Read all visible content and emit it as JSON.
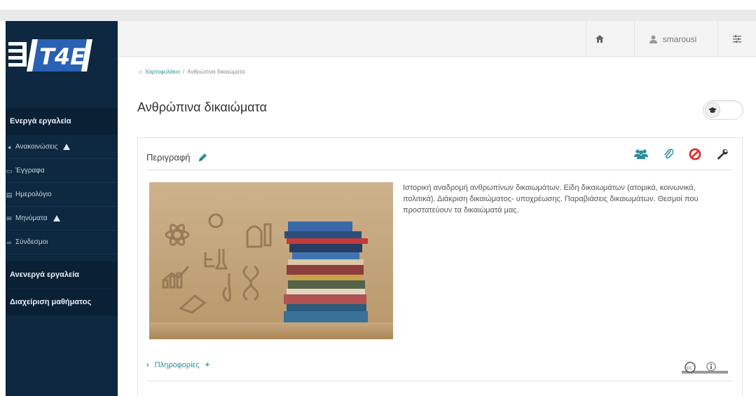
{
  "logo": {
    "text": "T4E"
  },
  "sidebar": {
    "active_tools_header": "Ενεργά εργαλεία",
    "items": [
      {
        "label": "Ανακοινώσεις",
        "icon": "announcement-icon",
        "warning": true
      },
      {
        "label": "Έγγραφα",
        "icon": "folder-icon",
        "warning": false
      },
      {
        "label": "Ημερολόγιο",
        "icon": "calendar-icon",
        "warning": false
      },
      {
        "label": "Μηνύματα",
        "icon": "envelope-icon",
        "warning": true
      },
      {
        "label": "Σύνδεσμοι",
        "icon": "link-icon",
        "warning": false
      }
    ],
    "inactive_tools_header": "Ανενεργά εργαλεία",
    "course_admin_header": "Διαχείριση μαθήματος"
  },
  "header": {
    "home_icon": "home-icon",
    "username": "smarousi",
    "user_icon": "user-icon",
    "settings_icon": "sliders-icon"
  },
  "breadcrumb": {
    "home": "Χαρτοφυλάκιο",
    "separator": "/",
    "current": "Ανθρώπινα δικαιώματα"
  },
  "page": {
    "title": "Ανθρώπινα δικαιώματα"
  },
  "panel": {
    "heading": "Περιγραφή",
    "description": "Ιστορική αναδρομή ανθρωπίνων δικαιωμάτων. Είδη δικαιωμάτων (ατομικά, κοινωνικά, πολιτικά). Διάκριση δικαιώματος- υποχρέωσης. Παραβιάσεις δικαιωμάτων. Θεσμοί που προστατεύουν τα δικαιώματά μας.",
    "info_label": "Πληροφορίες",
    "license": "cc-by"
  },
  "colors": {
    "sidebar_bg": "#0d2840",
    "teal": "#2a8f9a",
    "red": "#d9302e",
    "header_bg": "#f3f3f4"
  }
}
